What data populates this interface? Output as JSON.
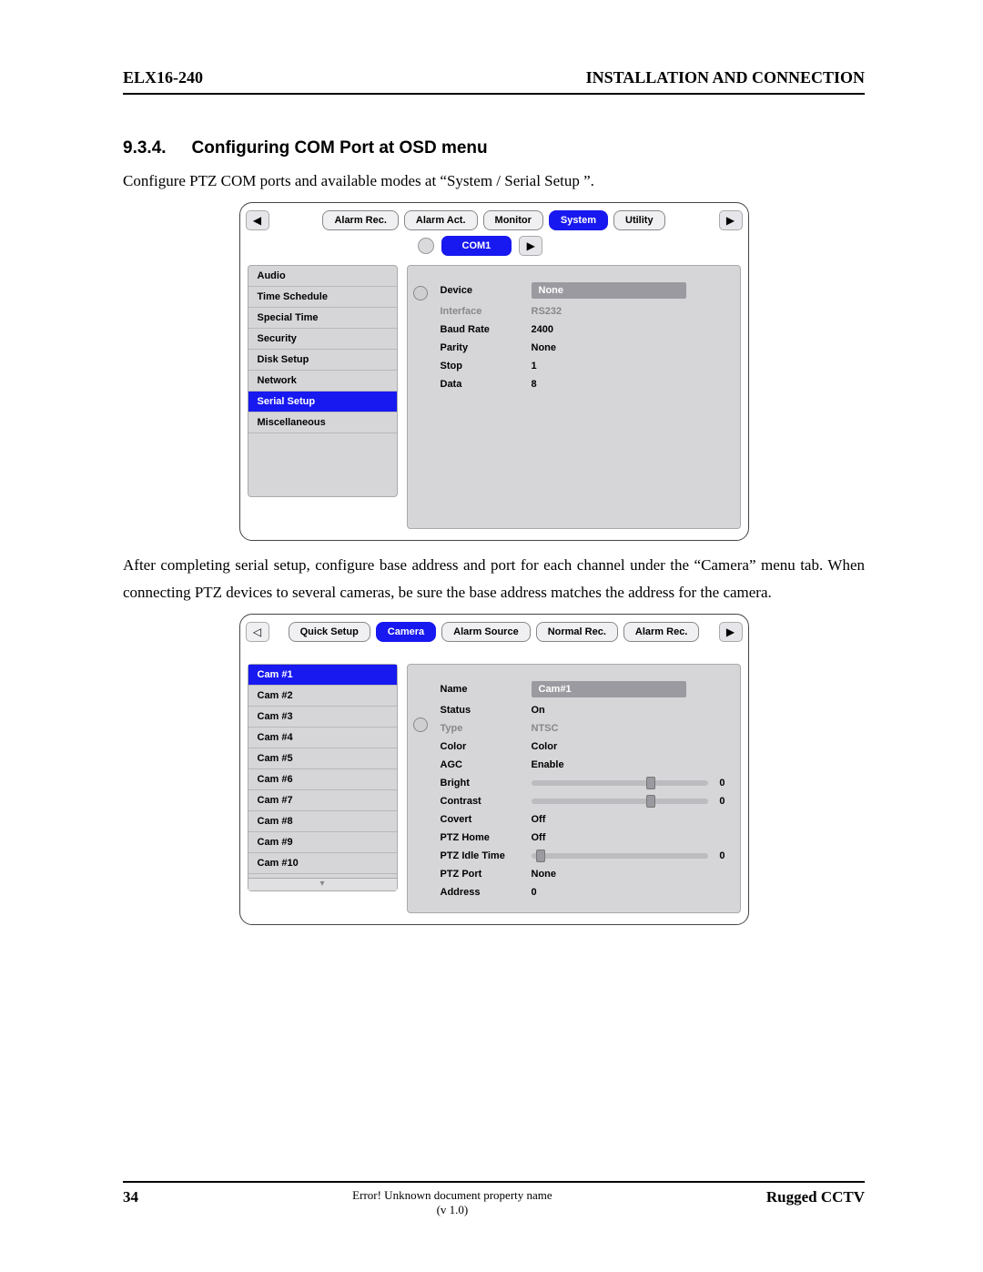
{
  "header": {
    "left": "ELX16-240",
    "right": "INSTALLATION AND CONNECTION"
  },
  "section": {
    "number": "9.3.4.",
    "title": "Configuring COM Port at OSD menu"
  },
  "para1": "Configure PTZ COM ports and available modes at “System / Serial Setup ”.",
  "shot1": {
    "tabs": [
      {
        "label": "Alarm Rec.",
        "active": false
      },
      {
        "label": "Alarm Act.",
        "active": false
      },
      {
        "label": "Monitor",
        "active": false
      },
      {
        "label": "System",
        "active": true
      },
      {
        "label": "Utility",
        "active": false
      }
    ],
    "com_label": "COM1",
    "left": [
      {
        "label": "Audio",
        "active": false
      },
      {
        "label": "Time Schedule",
        "active": false
      },
      {
        "label": "Special Time",
        "active": false
      },
      {
        "label": "Security",
        "active": false
      },
      {
        "label": "Disk Setup",
        "active": false
      },
      {
        "label": "Network",
        "active": false
      },
      {
        "label": "Serial Setup",
        "active": true
      },
      {
        "label": "Miscellaneous",
        "active": false
      }
    ],
    "rows": [
      {
        "label": "Device",
        "value": "None",
        "boxed": true
      },
      {
        "label": "Interface",
        "value": "RS232",
        "dim": true
      },
      {
        "label": "Baud Rate",
        "value": "2400"
      },
      {
        "label": "Parity",
        "value": "None"
      },
      {
        "label": "Stop",
        "value": "1"
      },
      {
        "label": "Data",
        "value": "8"
      }
    ]
  },
  "para2": "After completing serial setup, configure base address and port for each channel under the “Camera” menu tab. When connecting PTZ devices to several cameras, be sure the base address matches the address for the camera.",
  "shot2": {
    "tabs": [
      {
        "label": "Quick Setup",
        "active": false
      },
      {
        "label": "Camera",
        "active": true
      },
      {
        "label": "Alarm Source",
        "active": false
      },
      {
        "label": "Normal Rec.",
        "active": false
      },
      {
        "label": "Alarm Rec.",
        "active": false
      }
    ],
    "left": [
      {
        "label": "Cam #1",
        "active": true
      },
      {
        "label": "Cam #2",
        "active": false
      },
      {
        "label": "Cam #3",
        "active": false
      },
      {
        "label": "Cam #4",
        "active": false
      },
      {
        "label": "Cam #5",
        "active": false
      },
      {
        "label": "Cam #6",
        "active": false
      },
      {
        "label": "Cam #7",
        "active": false
      },
      {
        "label": "Cam #8",
        "active": false
      },
      {
        "label": "Cam #9",
        "active": false
      },
      {
        "label": "Cam #10",
        "active": false
      }
    ],
    "rows": [
      {
        "label": "Name",
        "value": "Cam#1",
        "boxed": true
      },
      {
        "label": "Status",
        "value": "On"
      },
      {
        "label": "Type",
        "value": "NTSC",
        "dim": true
      },
      {
        "label": "Color",
        "value": "Color"
      },
      {
        "label": "AGC",
        "value": "Enable"
      },
      {
        "label": "Bright",
        "slider": "center",
        "num": "0"
      },
      {
        "label": "Contrast",
        "slider": "center",
        "num": "0"
      },
      {
        "label": "Covert",
        "value": "Off"
      },
      {
        "label": "PTZ Home",
        "value": "Off"
      },
      {
        "label": "PTZ Idle Time",
        "slider": "left",
        "num": "0"
      },
      {
        "label": "PTZ Port",
        "value": "None"
      },
      {
        "label": "Address",
        "value": "0"
      }
    ]
  },
  "footer": {
    "page": "34",
    "mid1": "Error! Unknown document property name",
    "mid2": "(v 1.0)",
    "right": "Rugged CCTV"
  }
}
